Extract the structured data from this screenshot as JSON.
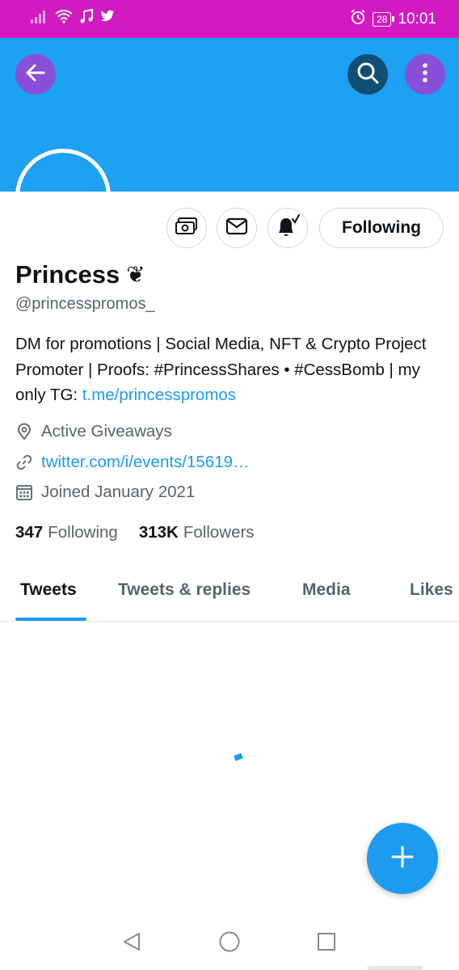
{
  "status_bar": {
    "time": "10:01",
    "battery": "28",
    "icons": [
      "signal-icon",
      "wifi-icon",
      "music-icon",
      "twitter-bird-icon",
      "alarm-icon",
      "battery-icon"
    ],
    "background_color": "#d31ac0"
  },
  "header": {
    "banner_color": "#1da1f2",
    "back_icon": "back-arrow-icon",
    "search_icon": "search-icon",
    "more_icon": "more-vertical-icon"
  },
  "profile": {
    "display_name": "Princess",
    "name_emoji": "❦",
    "handle": "@princesspromos_",
    "bio_text": "DM for promotions | Social Media, NFT & Crypto Project Promoter | Proofs: #PrincessShares • #CessBomb | my only TG: ",
    "bio_link": "t.me/princesspromos",
    "location": "Active Giveaways",
    "website": "twitter.com/i/events/15619…",
    "joined": "Joined January 2021",
    "following_count": "347",
    "following_label": "Following",
    "followers_count": "313K",
    "followers_label": "Followers"
  },
  "actions": {
    "tip_icon": "tip-money-icon",
    "message_icon": "envelope-icon",
    "notify_icon": "bell-check-icon",
    "following_button": "Following"
  },
  "tabs": [
    {
      "label": "Tweets",
      "active": true
    },
    {
      "label": "Tweets & replies",
      "active": false
    },
    {
      "label": "Media",
      "active": false
    },
    {
      "label": "Likes",
      "active": false
    }
  ],
  "fab": {
    "icon": "plus-icon"
  },
  "nav": {
    "back": "nav-back-icon",
    "home": "nav-home-icon",
    "recent": "nav-recent-icon"
  },
  "colors": {
    "accent": "#1d9bf0",
    "text": "#0f1419",
    "muted": "#536471"
  }
}
